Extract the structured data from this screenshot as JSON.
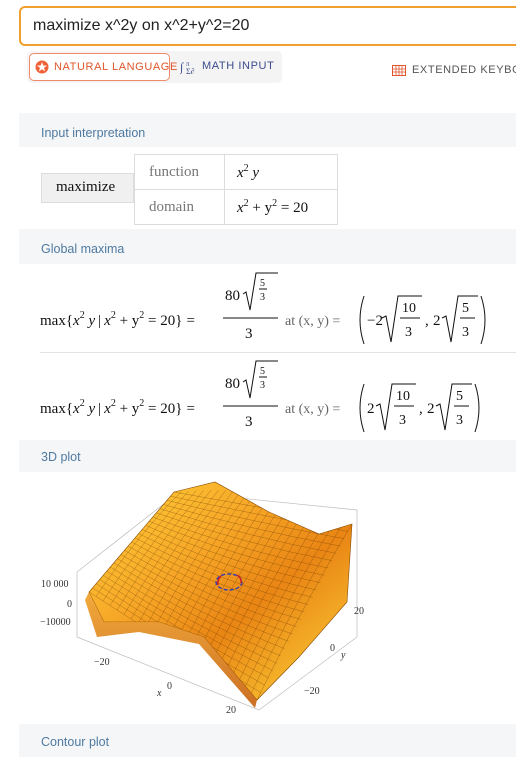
{
  "search": {
    "query": "maximize x^2y on x^2+y^2=20"
  },
  "modes": {
    "natural_language": "NATURAL LANGUAGE",
    "math_input": "MATH INPUT",
    "extended_keyboard": "EXTENDED KEYBOA"
  },
  "pods": {
    "input_interpretation": {
      "title": "Input interpretation",
      "action": "maximize",
      "rows": [
        {
          "label": "function",
          "value_parts": [
            "x",
            "2",
            " y"
          ]
        },
        {
          "label": "domain",
          "value_parts": [
            "x",
            "2",
            " + y",
            "2",
            " = 20"
          ]
        }
      ]
    },
    "global_maxima": {
      "title": "Global maxima",
      "results": [
        {
          "value_num": "80",
          "value_den": "3",
          "root_num": "5",
          "root_den": "3",
          "at": "at (x, y) =",
          "x_sign": "−2",
          "x_num": "10",
          "x_den": "3",
          "y_coef": "2",
          "y_num": "5",
          "y_den": "3"
        },
        {
          "value_num": "80",
          "value_den": "3",
          "root_num": "5",
          "root_den": "3",
          "at": "at (x, y) =",
          "x_sign": "2",
          "x_num": "10",
          "x_den": "3",
          "y_coef": "2",
          "y_num": "5",
          "y_den": "3"
        }
      ],
      "max_lhs": {
        "max": "max",
        "brace_open": "{",
        "x": "x",
        "exp": "2",
        "y": " y",
        "bar": "|",
        "x2": "x",
        "exp2": "2",
        "plus": " + y",
        "exp3": "2",
        "eq": " = 20",
        "brace_close": "}",
        "equals": "="
      }
    },
    "plot3d": {
      "title": "3D plot",
      "z_ticks": [
        "10 000",
        "0",
        "−10000"
      ],
      "x_ticks": [
        "−20",
        "0",
        "20"
      ],
      "y_ticks": [
        "20",
        "0",
        "−20"
      ],
      "x_label": "x",
      "y_label": "y"
    },
    "contour": {
      "title": "Contour plot"
    }
  },
  "colors": {
    "accent": "#f0a02c",
    "nl": "#e0552b",
    "pod_title": "#4f7aa0"
  }
}
